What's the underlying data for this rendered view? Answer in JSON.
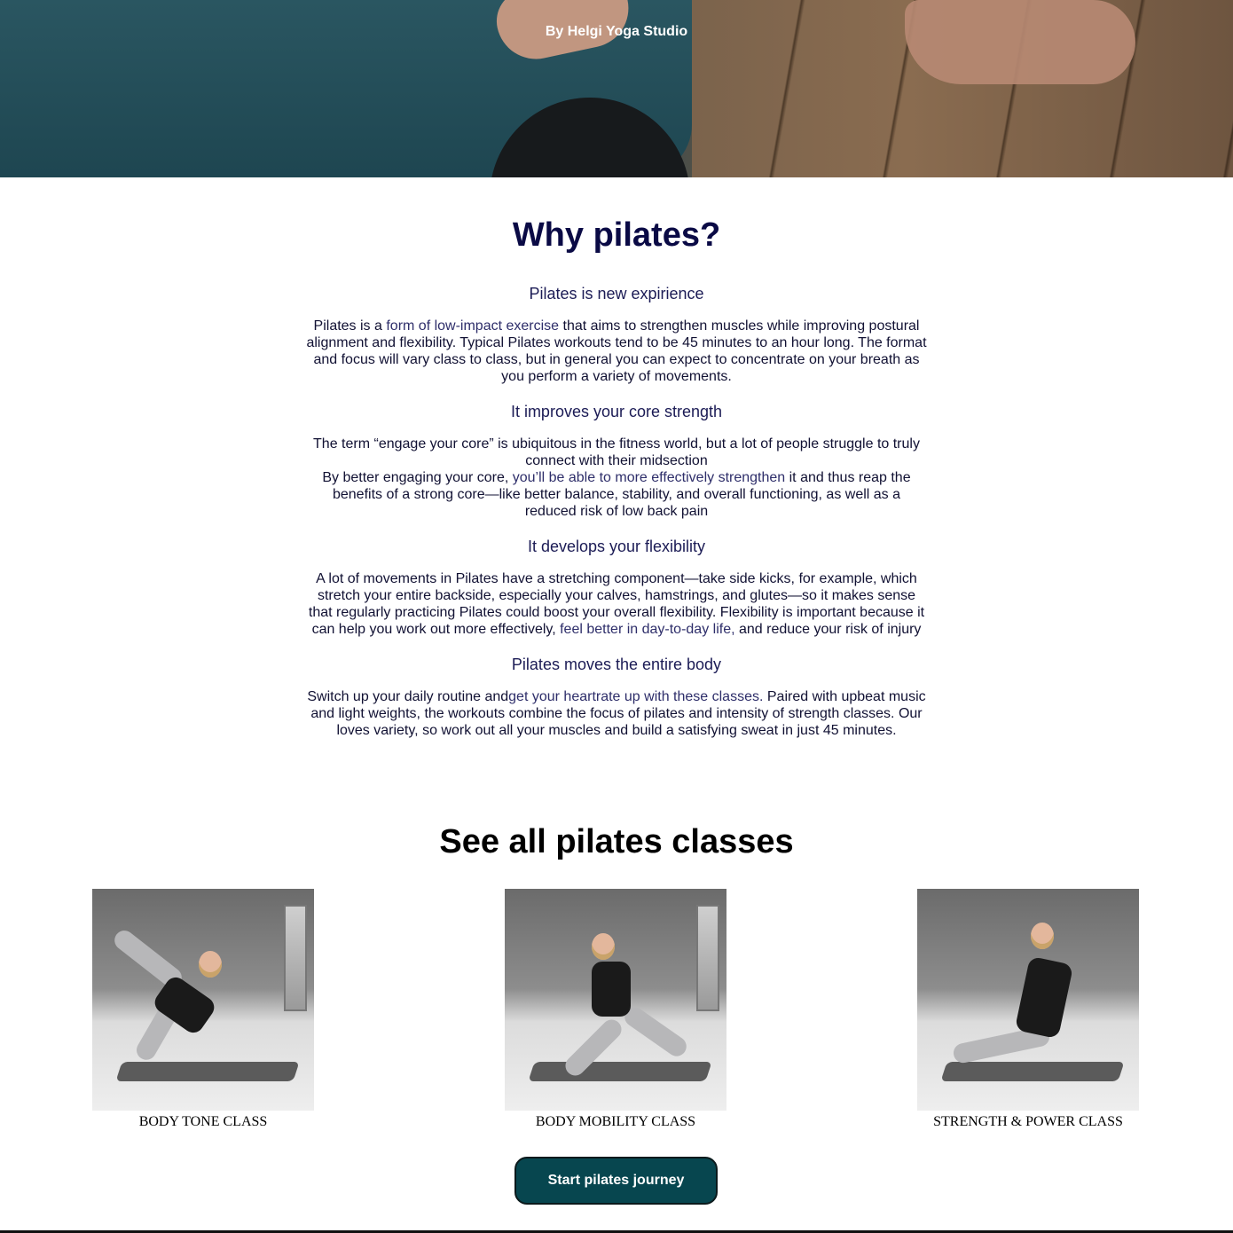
{
  "hero": {
    "studio": "By Helgi Yoga Studio"
  },
  "why": {
    "title": "Why pilates?",
    "sections": [
      {
        "heading": "Pilates is new expirience",
        "text_before": "Pilates is a ",
        "link": "form of low-impact exercise",
        "text_after": " that aims to strengthen muscles while improving postural alignment and flexibility. Typical Pilates workouts tend to be 45 minutes to an hour long. The format and focus will vary class to class, but in general you can expect to concentrate on your breath as you perform a variety of movements."
      },
      {
        "heading": "It improves your core strength",
        "line1": "The term “engage your core” is ubiquitous in the fitness world, but a lot of people struggle to truly connect with their midsection",
        "text_before": "By better engaging your core, ",
        "link": "you’ll be able to more effectively strengthen",
        "text_after": " it and thus reap the benefits of a strong core—like better balance, stability, and overall functioning, as well as a reduced risk of low back pain"
      },
      {
        "heading": "It develops your flexibility",
        "text_before": "A lot of movements in Pilates have a stretching component—take side kicks, for example, which stretch your entire backside, especially your calves, hamstrings, and glutes—so it makes sense that regularly practicing Pilates could boost your overall flexibility. Flexibility is important because it can help you work out more effectively, ",
        "link": "feel better in day-to-day life,",
        "text_after": " and reduce your risk of injury"
      },
      {
        "heading": "Pilates moves the entire body",
        "text_before": "Switch up your daily routine and",
        "link": "get your heartrate up with these classes.",
        "text_after": " Paired with upbeat music and light weights, the workouts combine the focus of pilates and intensity of strength classes. Our loves variety, so work out all your muscles and build a satisfying sweat in just 45 minutes."
      }
    ]
  },
  "classes": {
    "title": "See all pilates classes",
    "items": [
      {
        "label": "BODY TONE CLASS"
      },
      {
        "label": "BODY MOBILITY CLASS"
      },
      {
        "label": "STRENGTH & POWER CLASS"
      }
    ],
    "cta": "Start pilates journey"
  }
}
